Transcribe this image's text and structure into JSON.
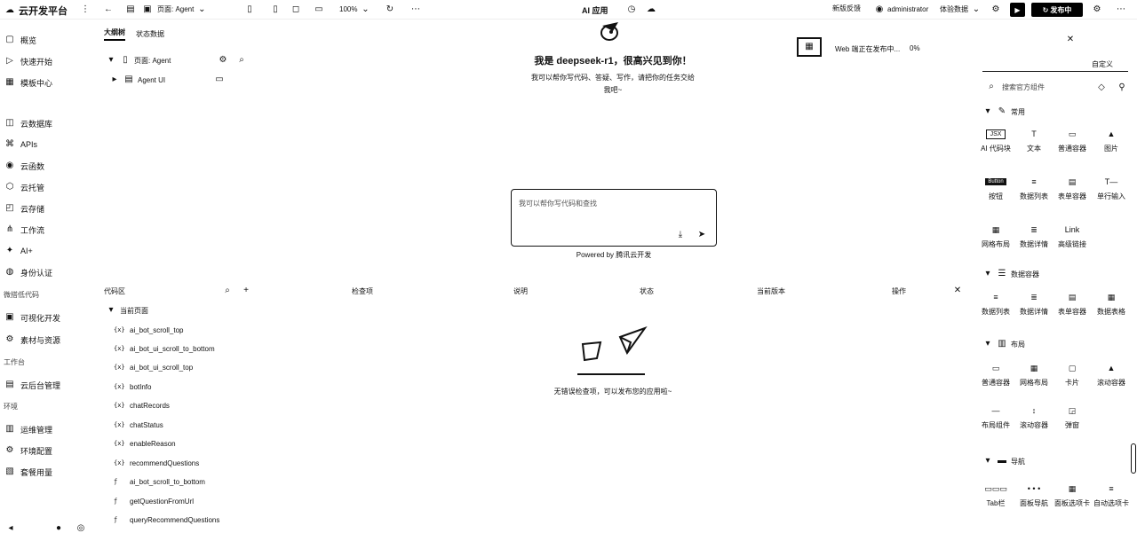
{
  "topbar": {
    "brand": "云开发平台",
    "page_label": "页面: Agent",
    "zoom": "100%",
    "center_title": "AI 应用",
    "new_feedback": "新版反馈",
    "user": "administrator",
    "env": "体验数据",
    "publish": "发布中"
  },
  "sidebar": {
    "items_a": [
      {
        "icon": "▢",
        "label": "概览"
      },
      {
        "icon": "▷",
        "label": "快速开始"
      },
      {
        "icon": "▦",
        "label": "模板中心"
      }
    ],
    "items_b": [
      {
        "icon": "◫",
        "label": "云数据库"
      },
      {
        "icon": "⌘",
        "label": "APIs"
      },
      {
        "icon": "◉",
        "label": "云函数"
      },
      {
        "icon": "⬡",
        "label": "云托管"
      },
      {
        "icon": "◰",
        "label": "云存储"
      },
      {
        "icon": "⋔",
        "label": "工作流"
      },
      {
        "icon": "✦",
        "label": "AI+"
      },
      {
        "icon": "◍",
        "label": "身份认证"
      }
    ],
    "section_lowcode": "微搭低代码",
    "items_c": [
      {
        "icon": "▣",
        "label": "可视化开发"
      },
      {
        "icon": "⚙",
        "label": "素材与资源"
      }
    ],
    "section_workbench": "工作台",
    "items_d": [
      {
        "icon": "▤",
        "label": "云后台管理"
      }
    ],
    "section_env": "环境",
    "items_e": [
      {
        "icon": "▥",
        "label": "运维管理"
      },
      {
        "icon": "⚙",
        "label": "环境配置"
      },
      {
        "icon": "▧",
        "label": "套餐用量"
      }
    ]
  },
  "outline": {
    "tab_outline": "大纲树",
    "tab_state": "状态数据",
    "page_node": "页面: Agent",
    "child_node": "Agent UI"
  },
  "center": {
    "greeting": "我是 deepseek-r1，很高兴见到你！",
    "desc_line1": "我可以帮你写代码、答疑、写作，请把你的任务交给",
    "desc_line2": "我吧~",
    "input_placeholder": "我可以帮你写代码和查找",
    "powered": "Powered by 腾讯云开发",
    "notice": "Web 端正在发布中...",
    "progress": "0%"
  },
  "code_panel": {
    "title": "代码区",
    "group": "当前页面",
    "items": [
      {
        "tag": "{x}",
        "label": "ai_bot_scroll_top"
      },
      {
        "tag": "{x}",
        "label": "ai_bot_ui_scroll_to_bottom"
      },
      {
        "tag": "{x}",
        "label": "ai_bot_ui_scroll_top"
      },
      {
        "tag": "{x}",
        "label": "botInfo"
      },
      {
        "tag": "{x}",
        "label": "chatRecords"
      },
      {
        "tag": "{x}",
        "label": "chatStatus"
      },
      {
        "tag": "{x}",
        "label": "enableReason"
      },
      {
        "tag": "{x}",
        "label": "recommendQuestions"
      },
      {
        "tag": "ƒ",
        "label": "ai_bot_scroll_to_bottom"
      },
      {
        "tag": "ƒ",
        "label": "getQuestionFromUrl"
      },
      {
        "tag": "ƒ",
        "label": "queryRecommendQuestions"
      }
    ],
    "columns": [
      "检查项",
      "说明",
      "状态",
      "当前版本",
      "操作"
    ],
    "empty_text": "无错误检查项，可以发布您的应用啦~"
  },
  "right_panel": {
    "tab_custom": "自定义",
    "search_placeholder": "搜索官方组件",
    "sec_common": "常用",
    "common": [
      {
        "thumb": "JSX",
        "label": "AI 代码块"
      },
      {
        "thumb": "T",
        "label": "文本"
      },
      {
        "thumb": "▭",
        "label": "普通容器"
      },
      {
        "thumb": "▲",
        "label": "图片"
      },
      {
        "thumb": "Button",
        "label": "按钮"
      },
      {
        "thumb": "≡",
        "label": "数据列表"
      },
      {
        "thumb": "▤",
        "label": "表单容器"
      },
      {
        "thumb": "T—",
        "label": "单行输入"
      },
      {
        "thumb": "▦",
        "label": "网格布局"
      },
      {
        "thumb": "≣",
        "label": "数据详情"
      },
      {
        "thumb": "Link",
        "label": "高级链接"
      }
    ],
    "sec_data": "数据容器",
    "data": [
      {
        "thumb": "≡",
        "label": "数据列表"
      },
      {
        "thumb": "≣",
        "label": "数据详情"
      },
      {
        "thumb": "▤",
        "label": "表单容器"
      },
      {
        "thumb": "▦",
        "label": "数据表格"
      }
    ],
    "sec_layout": "布局",
    "layout": [
      {
        "thumb": "▭",
        "label": "普通容器"
      },
      {
        "thumb": "▦",
        "label": "网格布局"
      },
      {
        "thumb": "▢",
        "label": "卡片"
      },
      {
        "thumb": "▲",
        "label": "滚动容器"
      },
      {
        "thumb": "—",
        "label": "布局组件"
      },
      {
        "thumb": "↕",
        "label": "滚动容器"
      },
      {
        "thumb": "◲",
        "label": "弹窗"
      }
    ],
    "sec_nav": "导航",
    "nav": [
      {
        "thumb": "▭▭▭",
        "label": "Tab栏"
      },
      {
        "thumb": "• • •",
        "label": "面板导航"
      },
      {
        "thumb": "▦",
        "label": "面板选项卡"
      },
      {
        "thumb": "≡",
        "label": "自动选项卡"
      }
    ]
  }
}
